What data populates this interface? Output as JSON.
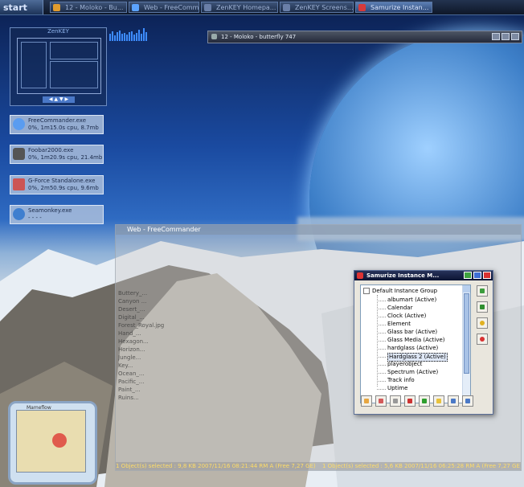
{
  "taskbar": {
    "start_label": "start",
    "tasks": [
      {
        "label": "12 - Moloko - Bu...",
        "active": false,
        "icon": "winamp-icon"
      },
      {
        "label": "Web - FreeComm...",
        "active": false,
        "icon": "freecommander-icon"
      },
      {
        "label": "ZenKEY Homepa...",
        "active": false,
        "icon": "browser-icon"
      },
      {
        "label": "ZenKEY Screens...",
        "active": false,
        "icon": "browser-icon"
      },
      {
        "label": "Samurize Instan...",
        "active": true,
        "icon": "samurize-icon"
      }
    ]
  },
  "zenkey": {
    "title": "ZenKEY"
  },
  "processes": [
    {
      "name": "FreeCommander.exe",
      "stats": "0%, 1m15.0s cpu, 8.7mb",
      "icon": "freecommander-icon"
    },
    {
      "name": "Foobar2000.exe",
      "stats": "0%, 1m20.9s cpu, 21.4mb",
      "icon": "foobar-icon"
    },
    {
      "name": "G-Force Standalone.exe",
      "stats": "0%, 2m50.9s cpu, 9.6mb",
      "icon": "gforce-icon"
    },
    {
      "name": "Seamonkey.exe",
      "stats": "- - - -",
      "icon": "seamonkey-icon"
    }
  ],
  "music_window": {
    "title": "12 - Moloko - butterfly 747"
  },
  "freecommander": {
    "title": "Web - FreeCommander",
    "files": [
      "Buttery_...",
      "Canyon ...",
      "Desert_...",
      "Digital_...",
      "Forest_Royal.jpg",
      "Hand_...",
      "Hexagon...",
      "Horizon...",
      "Jungle...",
      "Key...",
      "Ocean_...",
      "Pacific_...",
      "Paint_...",
      "Ruins..."
    ],
    "status_left": "1 Object(s) selected  : 9,8 KB  2007/11/16  08:21:44 RM  A  (Free 7,27 GE)",
    "status_right": "1 Object(s) selected : 5,6 KB  2007/11/16  06:25:28 RM  A  (Free 7,27 GE)"
  },
  "samurize": {
    "title": "Samurize Instance M...",
    "root": "Default Instance Group",
    "items": [
      "albumart (Active)",
      "Calendar",
      "Clock (Active)",
      "Element",
      "Glass bar (Active)",
      "Glass Media (Active)",
      "hardglass (Active)",
      "Hardglass 2 (Active)",
      "playerobject",
      "Spectrum (Active)",
      "Track info",
      "Uptime"
    ],
    "selected_index": 7,
    "side_buttons": [
      "refresh-icon",
      "add-icon",
      "help-icon",
      "stop-icon"
    ],
    "bottom_buttons": [
      "new-icon",
      "edit-icon",
      "copy-icon",
      "delete-icon",
      "green-icon",
      "folder-icon",
      "export-icon",
      "import-icon"
    ]
  },
  "widget": {
    "label": "Mameflow"
  },
  "colors": {
    "accent": "#4a78c7",
    "selection": "#dfe8f7"
  }
}
